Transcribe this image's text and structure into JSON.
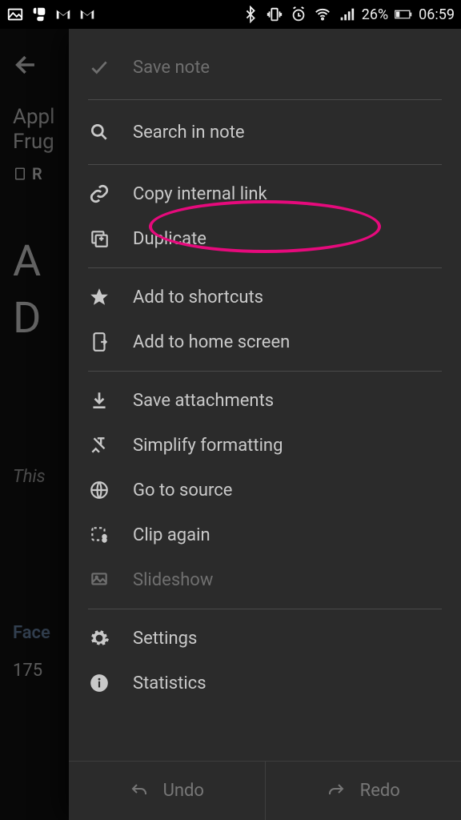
{
  "status": {
    "battery_text": "26%",
    "time": "06:59"
  },
  "background": {
    "title_line1": "Appl",
    "title_line2": "Frug",
    "chip": "R",
    "big_line1": "A",
    "big_line2": "D",
    "this_text": "This",
    "face_text": "Face",
    "count": "175"
  },
  "menu": {
    "save_note": "Save note",
    "search_in_note": "Search in note",
    "copy_internal_link": "Copy internal link",
    "duplicate": "Duplicate",
    "add_to_shortcuts": "Add to shortcuts",
    "add_to_home_screen": "Add to home screen",
    "save_attachments": "Save attachments",
    "simplify_formatting": "Simplify formatting",
    "go_to_source": "Go to source",
    "clip_again": "Clip again",
    "slideshow": "Slideshow",
    "settings": "Settings",
    "statistics": "Statistics"
  },
  "footer": {
    "undo": "Undo",
    "redo": "Redo"
  }
}
